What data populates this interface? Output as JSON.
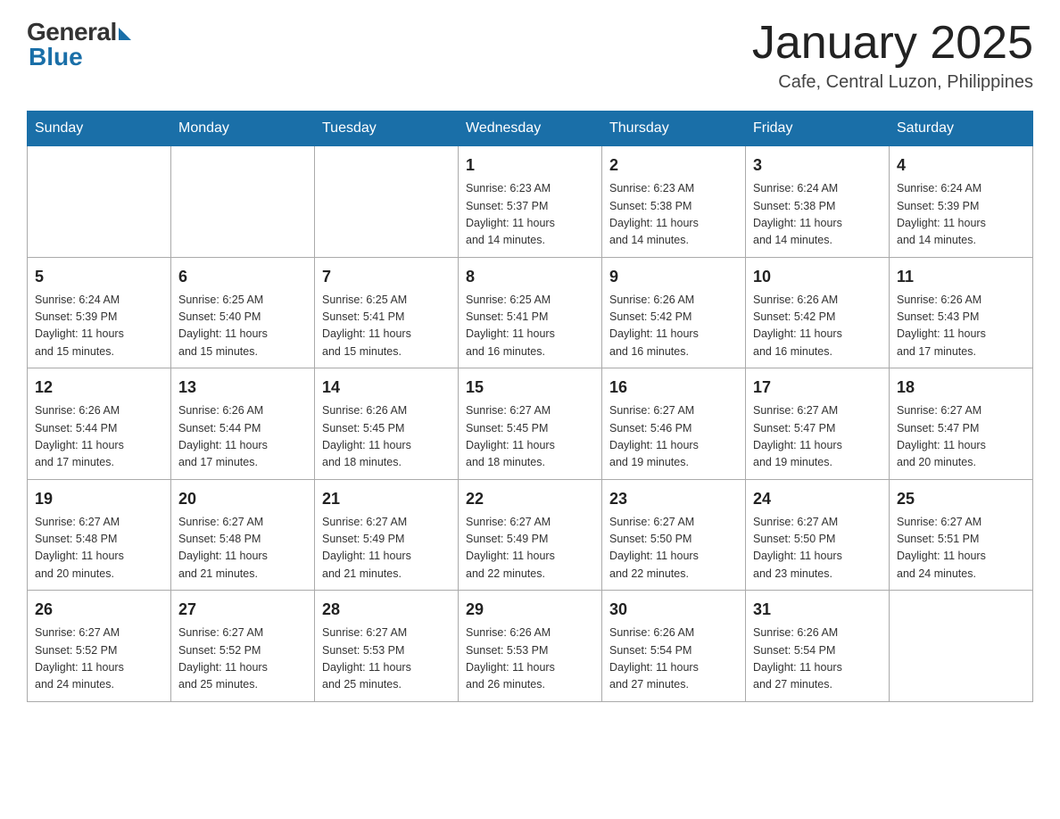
{
  "header": {
    "logo_general": "General",
    "logo_blue": "Blue",
    "title": "January 2025",
    "subtitle": "Cafe, Central Luzon, Philippines"
  },
  "days_of_week": [
    "Sunday",
    "Monday",
    "Tuesday",
    "Wednesday",
    "Thursday",
    "Friday",
    "Saturday"
  ],
  "weeks": [
    [
      {
        "day": "",
        "info": ""
      },
      {
        "day": "",
        "info": ""
      },
      {
        "day": "",
        "info": ""
      },
      {
        "day": "1",
        "info": "Sunrise: 6:23 AM\nSunset: 5:37 PM\nDaylight: 11 hours\nand 14 minutes."
      },
      {
        "day": "2",
        "info": "Sunrise: 6:23 AM\nSunset: 5:38 PM\nDaylight: 11 hours\nand 14 minutes."
      },
      {
        "day": "3",
        "info": "Sunrise: 6:24 AM\nSunset: 5:38 PM\nDaylight: 11 hours\nand 14 minutes."
      },
      {
        "day": "4",
        "info": "Sunrise: 6:24 AM\nSunset: 5:39 PM\nDaylight: 11 hours\nand 14 minutes."
      }
    ],
    [
      {
        "day": "5",
        "info": "Sunrise: 6:24 AM\nSunset: 5:39 PM\nDaylight: 11 hours\nand 15 minutes."
      },
      {
        "day": "6",
        "info": "Sunrise: 6:25 AM\nSunset: 5:40 PM\nDaylight: 11 hours\nand 15 minutes."
      },
      {
        "day": "7",
        "info": "Sunrise: 6:25 AM\nSunset: 5:41 PM\nDaylight: 11 hours\nand 15 minutes."
      },
      {
        "day": "8",
        "info": "Sunrise: 6:25 AM\nSunset: 5:41 PM\nDaylight: 11 hours\nand 16 minutes."
      },
      {
        "day": "9",
        "info": "Sunrise: 6:26 AM\nSunset: 5:42 PM\nDaylight: 11 hours\nand 16 minutes."
      },
      {
        "day": "10",
        "info": "Sunrise: 6:26 AM\nSunset: 5:42 PM\nDaylight: 11 hours\nand 16 minutes."
      },
      {
        "day": "11",
        "info": "Sunrise: 6:26 AM\nSunset: 5:43 PM\nDaylight: 11 hours\nand 17 minutes."
      }
    ],
    [
      {
        "day": "12",
        "info": "Sunrise: 6:26 AM\nSunset: 5:44 PM\nDaylight: 11 hours\nand 17 minutes."
      },
      {
        "day": "13",
        "info": "Sunrise: 6:26 AM\nSunset: 5:44 PM\nDaylight: 11 hours\nand 17 minutes."
      },
      {
        "day": "14",
        "info": "Sunrise: 6:26 AM\nSunset: 5:45 PM\nDaylight: 11 hours\nand 18 minutes."
      },
      {
        "day": "15",
        "info": "Sunrise: 6:27 AM\nSunset: 5:45 PM\nDaylight: 11 hours\nand 18 minutes."
      },
      {
        "day": "16",
        "info": "Sunrise: 6:27 AM\nSunset: 5:46 PM\nDaylight: 11 hours\nand 19 minutes."
      },
      {
        "day": "17",
        "info": "Sunrise: 6:27 AM\nSunset: 5:47 PM\nDaylight: 11 hours\nand 19 minutes."
      },
      {
        "day": "18",
        "info": "Sunrise: 6:27 AM\nSunset: 5:47 PM\nDaylight: 11 hours\nand 20 minutes."
      }
    ],
    [
      {
        "day": "19",
        "info": "Sunrise: 6:27 AM\nSunset: 5:48 PM\nDaylight: 11 hours\nand 20 minutes."
      },
      {
        "day": "20",
        "info": "Sunrise: 6:27 AM\nSunset: 5:48 PM\nDaylight: 11 hours\nand 21 minutes."
      },
      {
        "day": "21",
        "info": "Sunrise: 6:27 AM\nSunset: 5:49 PM\nDaylight: 11 hours\nand 21 minutes."
      },
      {
        "day": "22",
        "info": "Sunrise: 6:27 AM\nSunset: 5:49 PM\nDaylight: 11 hours\nand 22 minutes."
      },
      {
        "day": "23",
        "info": "Sunrise: 6:27 AM\nSunset: 5:50 PM\nDaylight: 11 hours\nand 22 minutes."
      },
      {
        "day": "24",
        "info": "Sunrise: 6:27 AM\nSunset: 5:50 PM\nDaylight: 11 hours\nand 23 minutes."
      },
      {
        "day": "25",
        "info": "Sunrise: 6:27 AM\nSunset: 5:51 PM\nDaylight: 11 hours\nand 24 minutes."
      }
    ],
    [
      {
        "day": "26",
        "info": "Sunrise: 6:27 AM\nSunset: 5:52 PM\nDaylight: 11 hours\nand 24 minutes."
      },
      {
        "day": "27",
        "info": "Sunrise: 6:27 AM\nSunset: 5:52 PM\nDaylight: 11 hours\nand 25 minutes."
      },
      {
        "day": "28",
        "info": "Sunrise: 6:27 AM\nSunset: 5:53 PM\nDaylight: 11 hours\nand 25 minutes."
      },
      {
        "day": "29",
        "info": "Sunrise: 6:26 AM\nSunset: 5:53 PM\nDaylight: 11 hours\nand 26 minutes."
      },
      {
        "day": "30",
        "info": "Sunrise: 6:26 AM\nSunset: 5:54 PM\nDaylight: 11 hours\nand 27 minutes."
      },
      {
        "day": "31",
        "info": "Sunrise: 6:26 AM\nSunset: 5:54 PM\nDaylight: 11 hours\nand 27 minutes."
      },
      {
        "day": "",
        "info": ""
      }
    ]
  ]
}
